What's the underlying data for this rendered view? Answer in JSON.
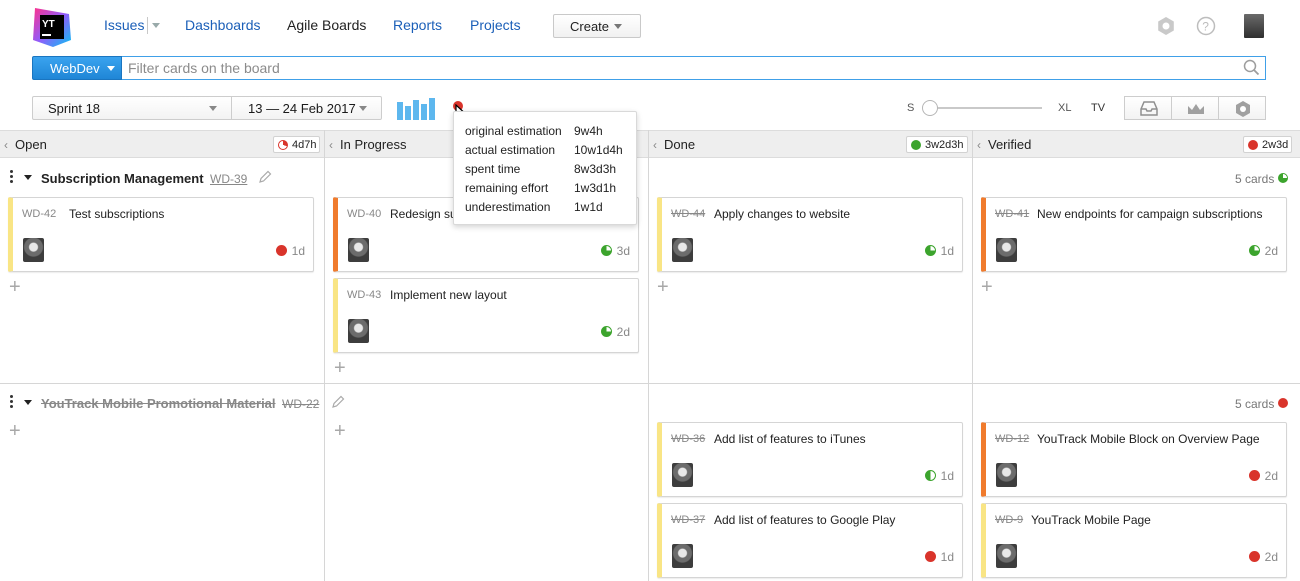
{
  "nav": {
    "issues": "Issues",
    "dashboards": "Dashboards",
    "agile_boards": "Agile Boards",
    "reports": "Reports",
    "projects": "Projects",
    "create": "Create"
  },
  "search": {
    "board": "WebDev",
    "placeholder": "Filter cards on the board"
  },
  "toolbar": {
    "sprint": "Sprint 18",
    "dates": "13 — 24 Feb 2017",
    "size_min": "S",
    "size_max": "XL",
    "tv": "TV"
  },
  "columns": [
    {
      "name": "Open",
      "estimate": "4d7h",
      "status": "red-pie"
    },
    {
      "name": "In Progress",
      "estimate": "",
      "status": ""
    },
    {
      "name": "Done",
      "estimate": "3w2d3h",
      "status": "green"
    },
    {
      "name": "Verified",
      "estimate": "2w3d",
      "status": "red"
    }
  ],
  "tooltip": {
    "rows": [
      {
        "label": "original estimation",
        "value": "9w4h"
      },
      {
        "label": "actual estimation",
        "value": "10w1d4h"
      },
      {
        "label": "spent time",
        "value": "8w3d3h"
      },
      {
        "label": "remaining effort",
        "value": "1w3d1h"
      },
      {
        "label": "underestimation",
        "value": "1w1d"
      }
    ]
  },
  "swimlanes": [
    {
      "title": "Subscription Management",
      "id": "WD-39",
      "resolved": false,
      "count": "5 cards",
      "count_status": "green-pie",
      "cards": {
        "open": [
          {
            "id": "WD-42",
            "title": "Test subscriptions",
            "estimate": "1d",
            "status": "red",
            "resolved": false,
            "color": "yellow"
          }
        ],
        "in_progress": [
          {
            "id": "WD-40",
            "title": "Redesign su",
            "estimate": "3d",
            "status": "green-pie",
            "resolved": false,
            "color": "orange"
          },
          {
            "id": "WD-43",
            "title": "Implement new layout",
            "estimate": "2d",
            "status": "green-pie",
            "resolved": false,
            "color": "yellow"
          }
        ],
        "done": [
          {
            "id": "WD-44",
            "title": "Apply changes to website",
            "estimate": "1d",
            "status": "green-pie",
            "resolved": true,
            "color": "yellow"
          }
        ],
        "verified": [
          {
            "id": "WD-41",
            "title": "New endpoints for campaign subscriptions",
            "estimate": "2d",
            "status": "green-pie",
            "resolved": true,
            "color": "orange"
          }
        ]
      }
    },
    {
      "title": "YouTrack Mobile Promotional Material",
      "id": "WD-22",
      "resolved": true,
      "count": "5 cards",
      "count_status": "red",
      "cards": {
        "done": [
          {
            "id": "WD-36",
            "title": "Add list of features to iTunes",
            "estimate": "1d",
            "status": "green-half",
            "resolved": true,
            "color": "yellow"
          },
          {
            "id": "WD-37",
            "title": "Add list of features to Google Play",
            "estimate": "1d",
            "status": "red",
            "resolved": true,
            "color": "yellow"
          }
        ],
        "verified": [
          {
            "id": "WD-12",
            "title": "YouTrack Mobile Block on Overview Page",
            "estimate": "2d",
            "status": "red",
            "resolved": true,
            "color": "orange"
          },
          {
            "id": "WD-9",
            "title": "YouTrack Mobile Page",
            "estimate": "2d",
            "status": "red",
            "resolved": true,
            "color": "yellow"
          }
        ]
      }
    }
  ],
  "colors": {
    "accent": "#1f86d6",
    "link": "#1b5fb8",
    "red": "#d9342b",
    "green": "#3ca42d",
    "orange": "#f07b2d",
    "yellow": "#f9e585"
  }
}
